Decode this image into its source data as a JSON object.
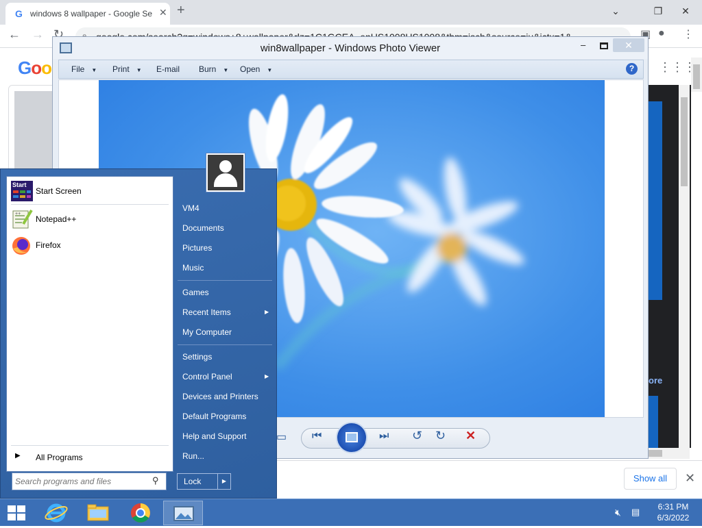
{
  "browser": {
    "tab_title": "windows 8 wallpaper - Google Se",
    "tab_favicon": "G",
    "tab_close": "✕",
    "new_tab": "+",
    "url": "google.com/search?q=windows+8+wallpaper&rlz=1C1GCEA_enUS1008US1008&tbm=isch&source=iu&ictx=1&",
    "logo": {
      "g1": "G",
      "o1": "o",
      "o2": "o"
    },
    "side_more": "ore",
    "show_all": "Show all",
    "download_close": "✕"
  },
  "photo_viewer": {
    "title": "win8wallpaper - Windows Photo Viewer",
    "menus": [
      {
        "label": "File"
      },
      {
        "label": "Print"
      },
      {
        "label": "E-mail"
      },
      {
        "label": "Burn"
      },
      {
        "label": "Open"
      }
    ],
    "help": "?",
    "close": "✕",
    "minimize": "–"
  },
  "start_menu": {
    "pinned": [
      {
        "label": "Start Screen",
        "icon": "start-screen-icon"
      },
      {
        "label": "Notepad++",
        "icon": "notepadpp-icon"
      },
      {
        "label": "Firefox",
        "icon": "firefox-icon"
      }
    ],
    "start_tile_text": "Start",
    "all_programs": "All Programs",
    "search_placeholder": "Search programs and files",
    "right": {
      "user": "VM4",
      "documents": "Documents",
      "pictures": "Pictures",
      "music": "Music",
      "games": "Games",
      "recent_items": "Recent Items",
      "my_computer": "My Computer",
      "settings": "Settings",
      "control_panel": "Control Panel",
      "devices_printers": "Devices and Printers",
      "default_programs": "Default Programs",
      "help_support": "Help and Support",
      "run": "Run..."
    },
    "lock": "Lock"
  },
  "taskbar": {
    "time": "6:31 PM",
    "date": "6/3/2022",
    "items": [
      "start-button",
      "internet-explorer",
      "file-explorer",
      "chrome",
      "photo-viewer"
    ]
  }
}
